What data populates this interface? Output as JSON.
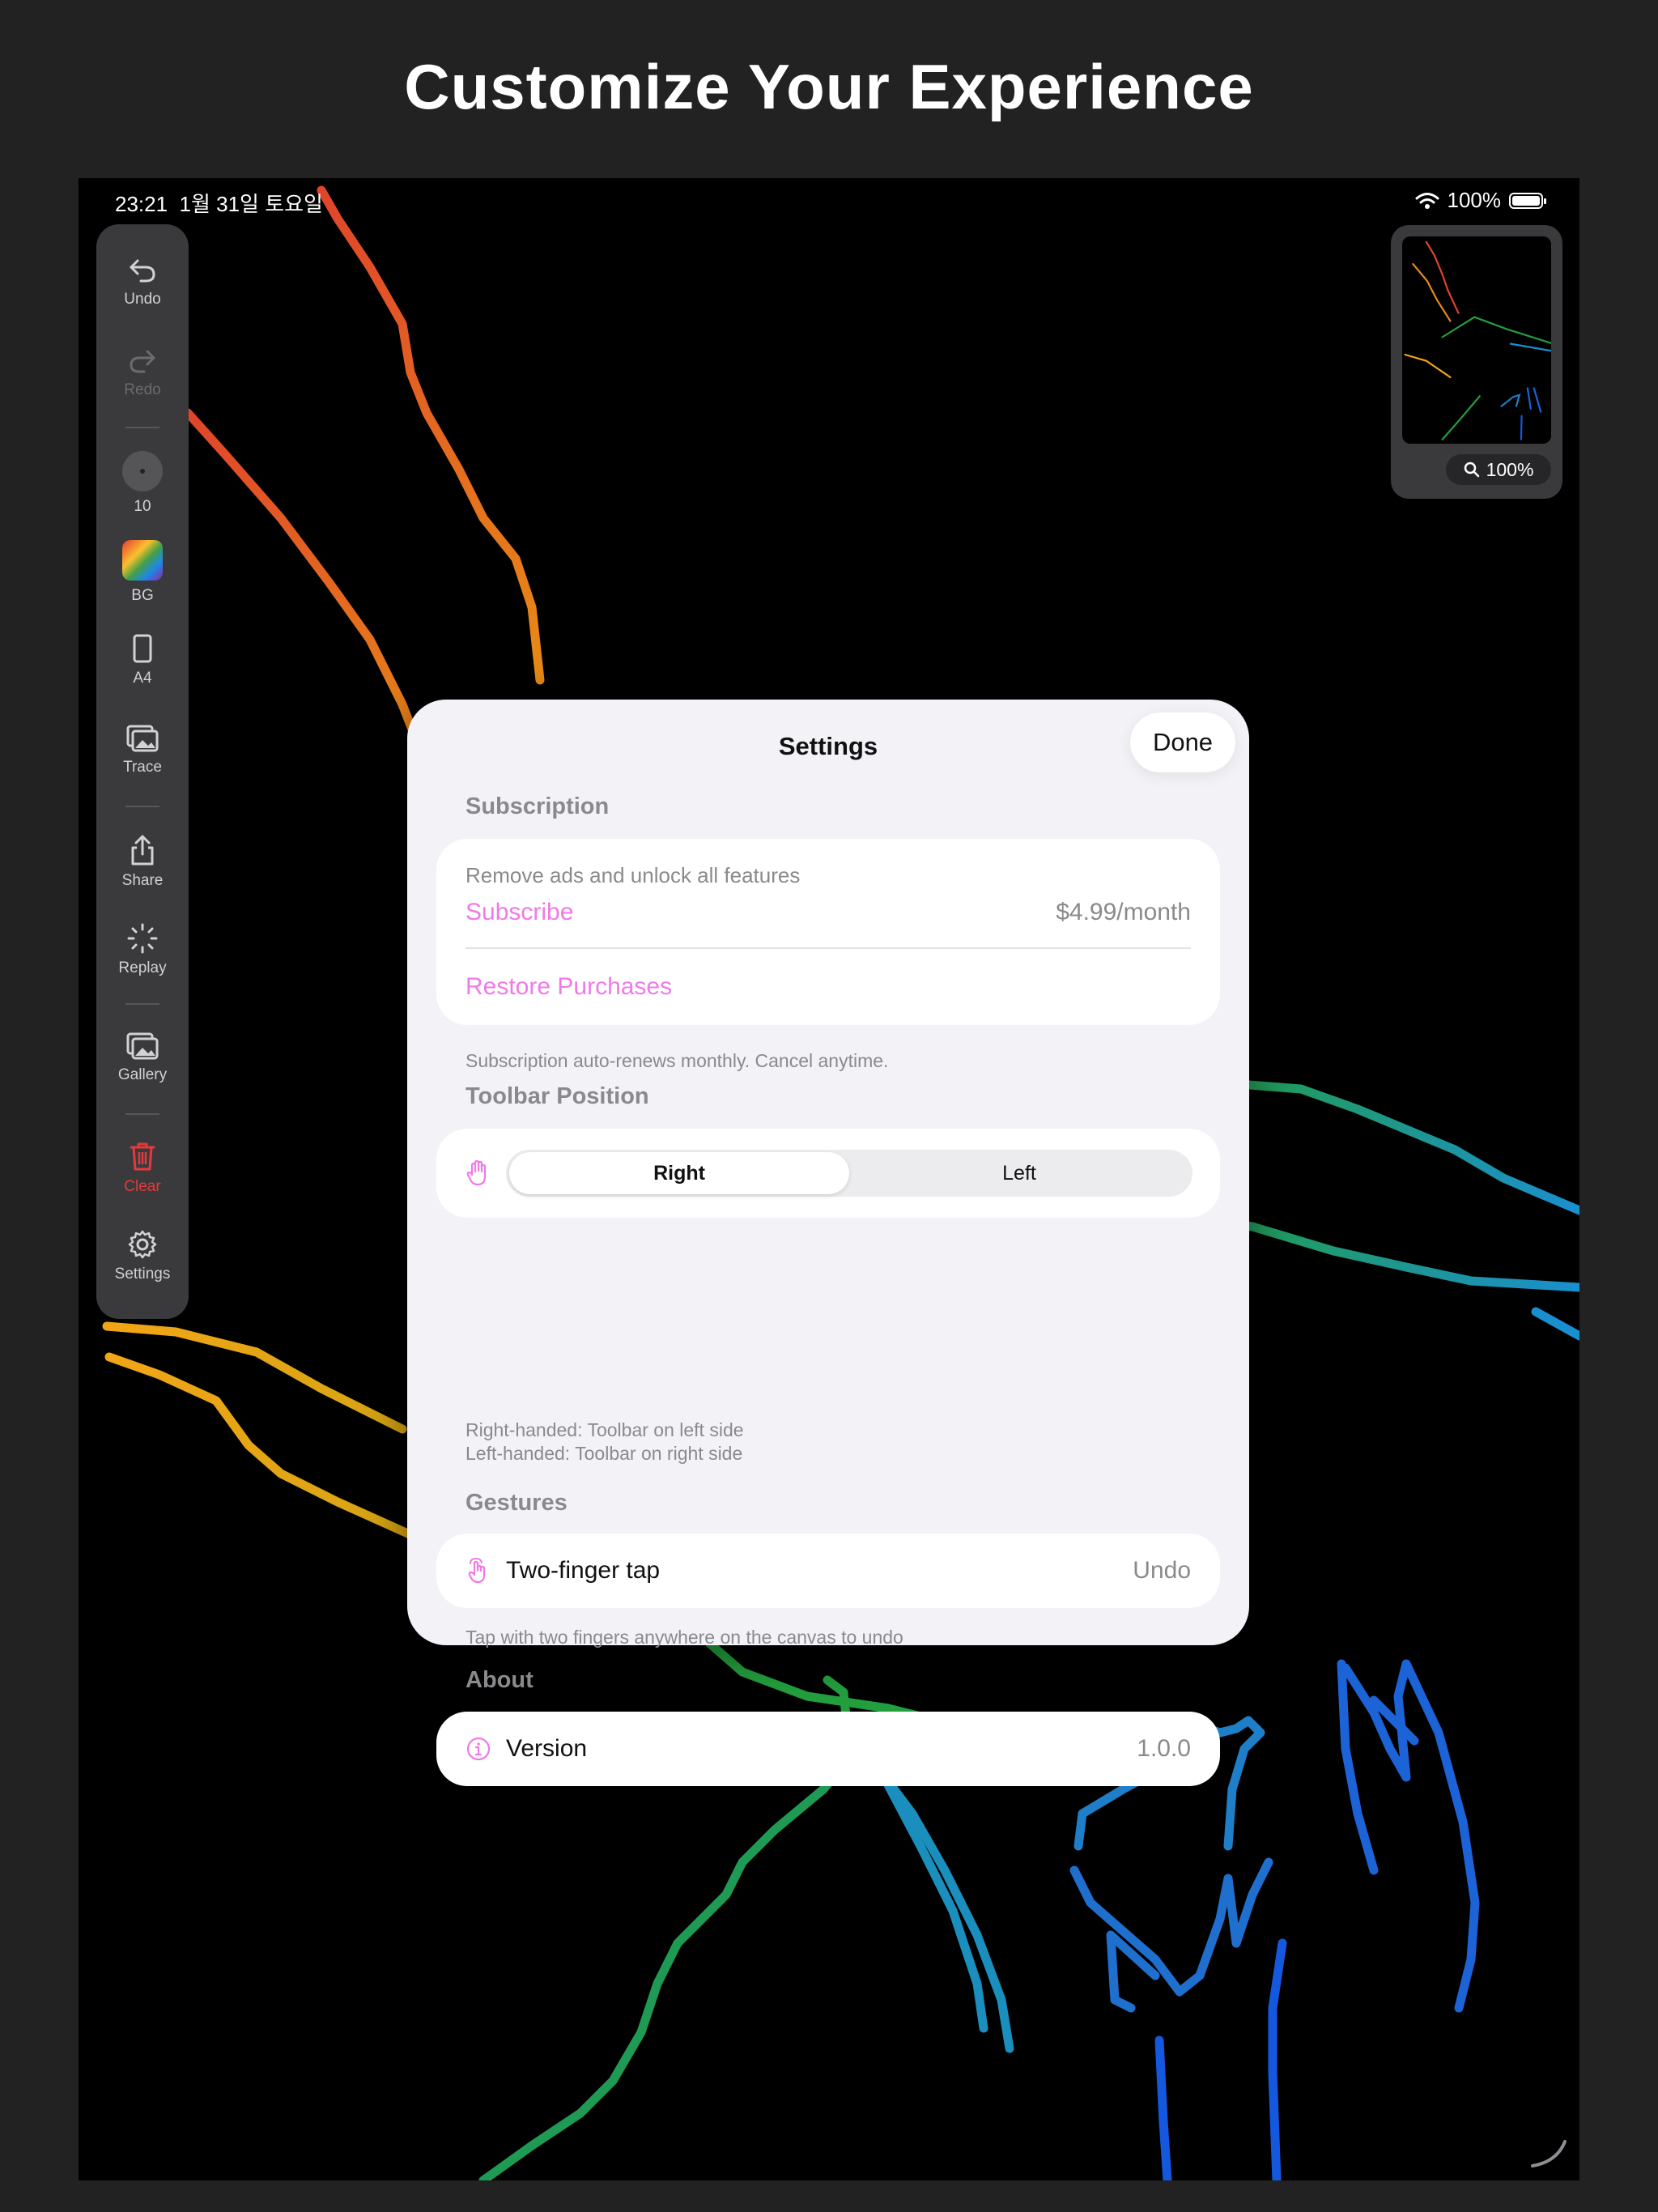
{
  "headline": "Customize Your Experience",
  "status": {
    "time": "23:21",
    "date": "1월 31일 토요일",
    "battery": "100%"
  },
  "toolbar": {
    "undo": "Undo",
    "redo": "Redo",
    "size": "10",
    "bg": "BG",
    "paper": "A4",
    "trace": "Trace",
    "share": "Share",
    "replay": "Replay",
    "gallery": "Gallery",
    "clear": "Clear",
    "settings": "Settings"
  },
  "navigator": {
    "zoom": "100%"
  },
  "settings": {
    "title": "Settings",
    "done": "Done",
    "subscription": {
      "header": "Subscription",
      "description": "Remove ads and unlock all features",
      "subscribe": "Subscribe",
      "price": "$4.99/month",
      "restore": "Restore Purchases",
      "footnote": "Subscription auto-renews monthly. Cancel anytime."
    },
    "toolbar_position": {
      "header": "Toolbar Position",
      "options": [
        "Right",
        "Left"
      ],
      "selected": "Right",
      "footnote_1": "Right-handed: Toolbar on left side",
      "footnote_2": "Left-handed: Toolbar on right side"
    },
    "gestures": {
      "header": "Gestures",
      "label": "Two-finger tap",
      "value": "Undo",
      "footnote": "Tap with two fingers anywhere on the canvas to undo"
    },
    "about": {
      "header": "About",
      "label": "Version",
      "value": "1.0.0"
    }
  },
  "colors": {
    "accent": "#f07ae8",
    "danger": "#e5393b",
    "sheet_bg": "#f2f2f7"
  }
}
